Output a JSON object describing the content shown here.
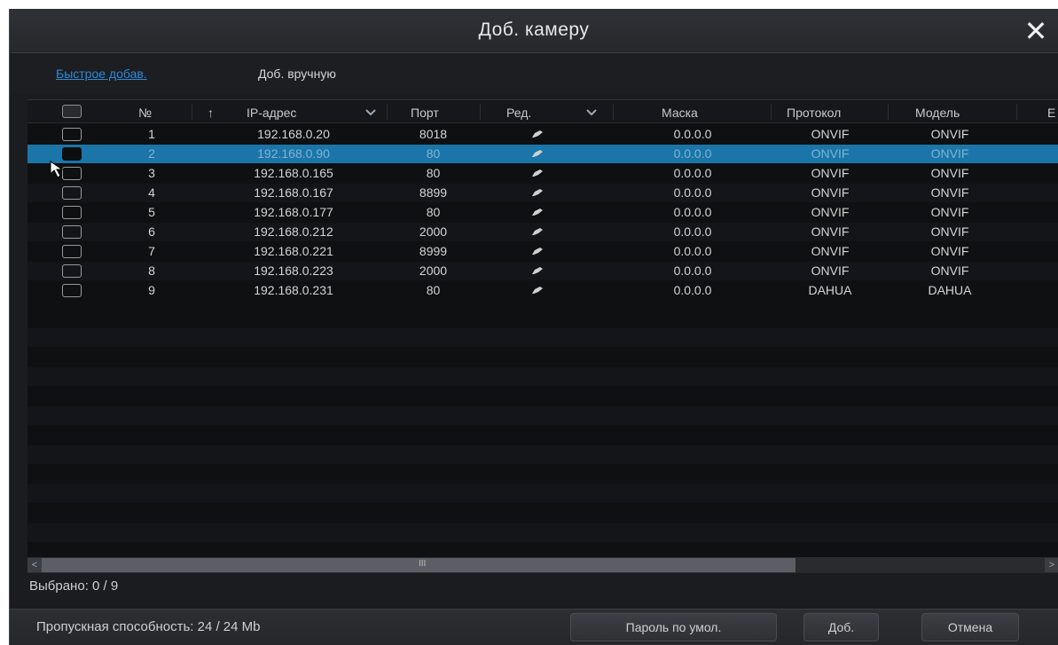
{
  "dialog": {
    "title": "Доб. камеру",
    "close": "✕"
  },
  "tabs": [
    {
      "label": "Быстрое добав.",
      "active": true
    },
    {
      "label": "Доб. вручную",
      "active": false
    }
  ],
  "table": {
    "headers": {
      "num": "№",
      "sort_arrow": "↑",
      "ip": "IP-адрес",
      "port": "Порт",
      "edit": "Ред.",
      "mask": "Маска",
      "protocol": "Протокол",
      "model": "Модель",
      "cut": "Е"
    },
    "rows": [
      {
        "num": "1",
        "ip": "192.168.0.20",
        "port": "8018",
        "mask": "0.0.0.0",
        "protocol": "ONVIF",
        "model": "ONVIF"
      },
      {
        "num": "2",
        "ip": "192.168.0.90",
        "port": "80",
        "mask": "0.0.0.0",
        "protocol": "ONVIF",
        "model": "ONVIF"
      },
      {
        "num": "3",
        "ip": "192.168.0.165",
        "port": "80",
        "mask": "0.0.0.0",
        "protocol": "ONVIF",
        "model": "ONVIF"
      },
      {
        "num": "4",
        "ip": "192.168.0.167",
        "port": "8899",
        "mask": "0.0.0.0",
        "protocol": "ONVIF",
        "model": "ONVIF"
      },
      {
        "num": "5",
        "ip": "192.168.0.177",
        "port": "80",
        "mask": "0.0.0.0",
        "protocol": "ONVIF",
        "model": "ONVIF"
      },
      {
        "num": "6",
        "ip": "192.168.0.212",
        "port": "2000",
        "mask": "0.0.0.0",
        "protocol": "ONVIF",
        "model": "ONVIF"
      },
      {
        "num": "7",
        "ip": "192.168.0.221",
        "port": "8999",
        "mask": "0.0.0.0",
        "protocol": "ONVIF",
        "model": "ONVIF"
      },
      {
        "num": "8",
        "ip": "192.168.0.223",
        "port": "2000",
        "mask": "0.0.0.0",
        "protocol": "ONVIF",
        "model": "ONVIF"
      },
      {
        "num": "9",
        "ip": "192.168.0.231",
        "port": "80",
        "mask": "0.0.0.0",
        "protocol": "DAHUA",
        "model": "DAHUA"
      }
    ],
    "selected_row": 2,
    "scrollbar_grip": "III",
    "scroll_left": "<",
    "scroll_right": ">"
  },
  "status": {
    "selected": "Выбрано: 0 / 9",
    "throughput": "Пропускная способность: 24 / 24 Mb"
  },
  "buttons": {
    "default_password": "Пароль по умол.",
    "add": "Доб.",
    "cancel": "Отмена"
  },
  "colors": {
    "accent": "#2b8bd8",
    "selected_row": "#1b75a8",
    "background": "#1b1c1f"
  }
}
